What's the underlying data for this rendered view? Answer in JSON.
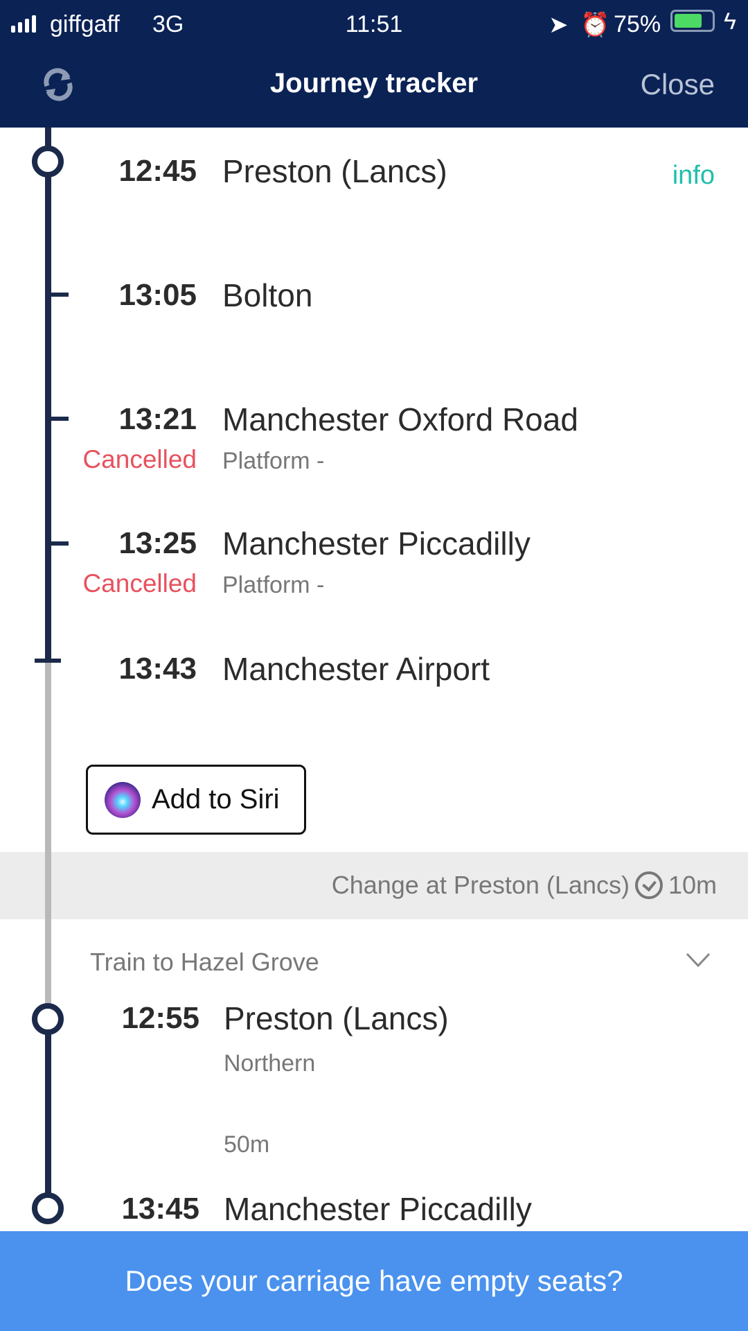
{
  "status_bar": {
    "carrier": "giffgaff",
    "network": "3G",
    "time": "11:51",
    "battery": "75%"
  },
  "header": {
    "title": "Journey tracker",
    "close_label": "Close",
    "refresh_icon": "refresh-icon"
  },
  "leg1": {
    "info_label": "info",
    "stops": [
      {
        "time": "12:45",
        "station": "Preston (Lancs)"
      },
      {
        "time": "13:05",
        "station": "Bolton"
      },
      {
        "time": "13:21",
        "station": "Manchester Oxford Road",
        "status": "Cancelled",
        "platform": "Platform -"
      },
      {
        "time": "13:25",
        "station": "Manchester Piccadilly",
        "status": "Cancelled",
        "platform": "Platform -"
      },
      {
        "time": "13:43",
        "station": "Manchester Airport"
      }
    ],
    "siri_label": "Add to Siri"
  },
  "change": {
    "text": "Change at Preston (Lancs)",
    "duration": "10m"
  },
  "leg2": {
    "title": "Train to Hazel Grove",
    "stops": [
      {
        "time": "12:55",
        "station": "Preston (Lancs)",
        "operator": "Northern"
      },
      {
        "time": "13:45",
        "station": "Manchester Piccadilly"
      }
    ],
    "duration": "50m"
  },
  "banner": {
    "text": "Does your carriage have empty seats?"
  },
  "colors": {
    "header": "#0b2255",
    "cancelled": "#e8515e",
    "info": "#1fbfa9",
    "banner": "#4a92ee"
  }
}
